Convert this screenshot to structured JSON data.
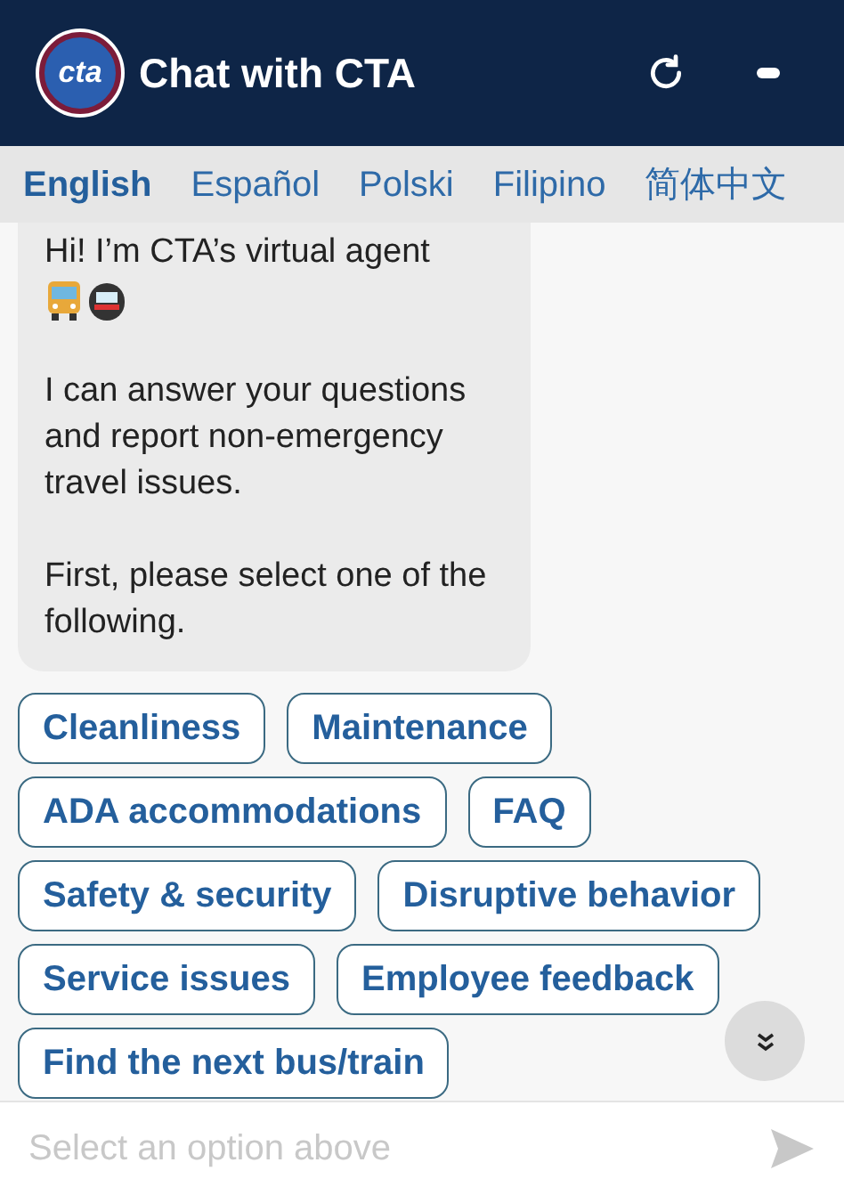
{
  "header": {
    "logo": "cta",
    "title": "Chat with CTA"
  },
  "languages": [
    {
      "label": "English",
      "selected": true
    },
    {
      "label": "Español",
      "selected": false
    },
    {
      "label": "Polski",
      "selected": false
    },
    {
      "label": "Filipino",
      "selected": false
    },
    {
      "label": "简体中文",
      "selected": false
    }
  ],
  "message": {
    "paragraphs": [
      "Hi! I’m CTA’s virtual agent",
      "I can answer your questions and report non-emergency travel issues.",
      "First, please select one of the following."
    ]
  },
  "options": [
    [
      "Cleanliness",
      "Maintenance"
    ],
    [
      "ADA accommodations",
      "FAQ"
    ],
    [
      "Safety & security",
      "Disruptive behavior"
    ],
    [
      "Service issues",
      "Employee feedback"
    ],
    [
      "Find the next bus/train"
    ]
  ],
  "input": {
    "placeholder": "Select an option above"
  }
}
